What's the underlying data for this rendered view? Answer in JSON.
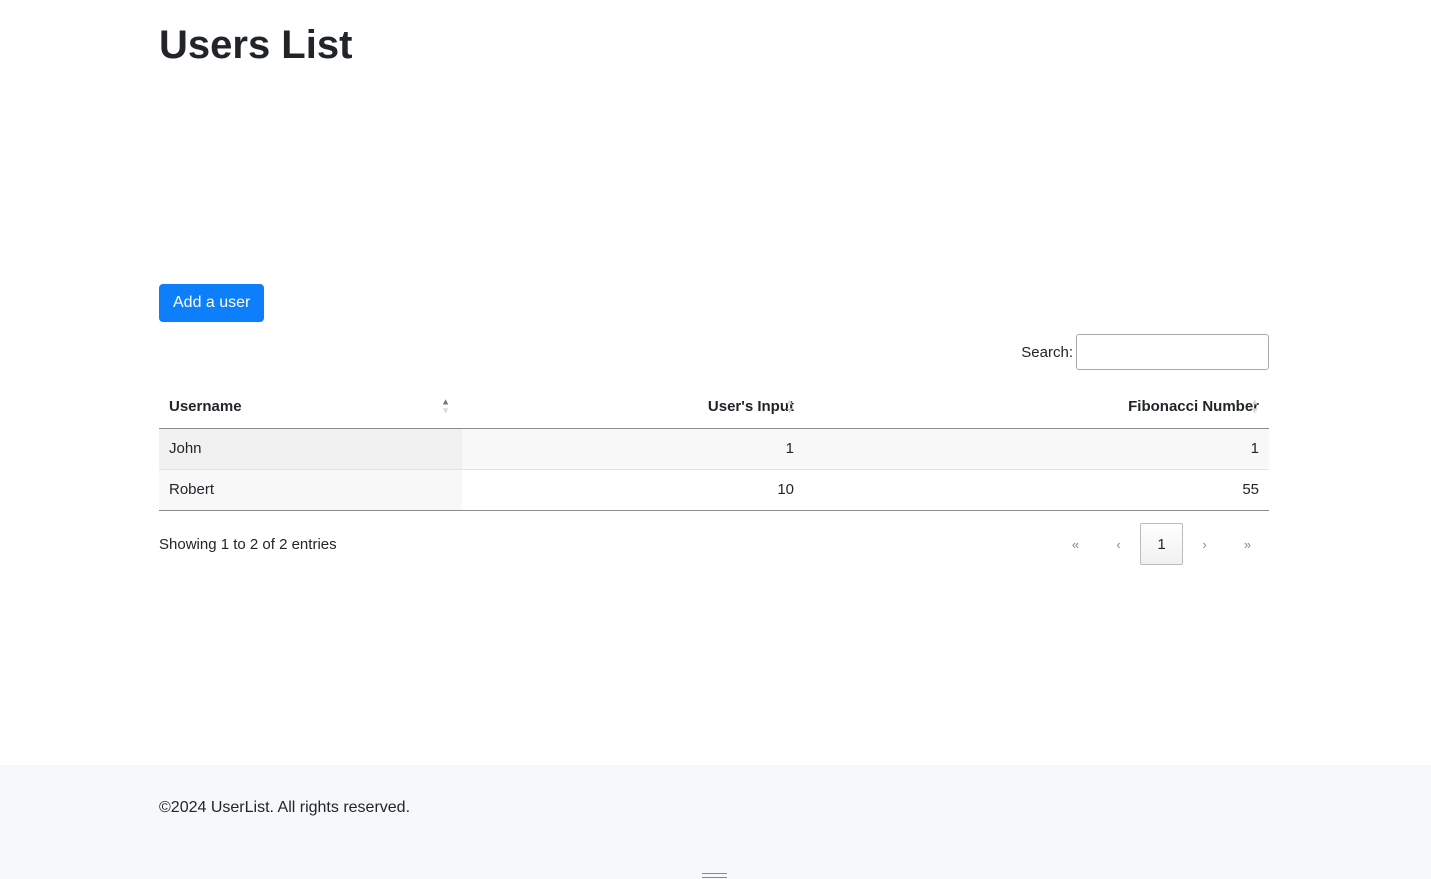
{
  "page": {
    "title": "Users List"
  },
  "toolbar": {
    "add_user_label": "Add a user"
  },
  "search": {
    "label": "Search:",
    "value": "",
    "placeholder": ""
  },
  "table": {
    "columns": [
      {
        "label": "Username",
        "sort": "ascending"
      },
      {
        "label": "User's Input",
        "sort": "none"
      },
      {
        "label": "Fibonacci Number",
        "sort": "none"
      }
    ],
    "rows": [
      {
        "username": "John",
        "input": "1",
        "fibonacci": "1"
      },
      {
        "username": "Robert",
        "input": "10",
        "fibonacci": "55"
      }
    ]
  },
  "info": {
    "text": "Showing 1 to 2 of 2 entries"
  },
  "pagination": {
    "first": "«",
    "previous": "‹",
    "current": "1",
    "next": "›",
    "last": "»"
  },
  "footer": {
    "text": "©2024 UserList. All rights reserved."
  },
  "colors": {
    "accent": "#0d7ffb",
    "footer_bg": "#f7f8fc"
  }
}
